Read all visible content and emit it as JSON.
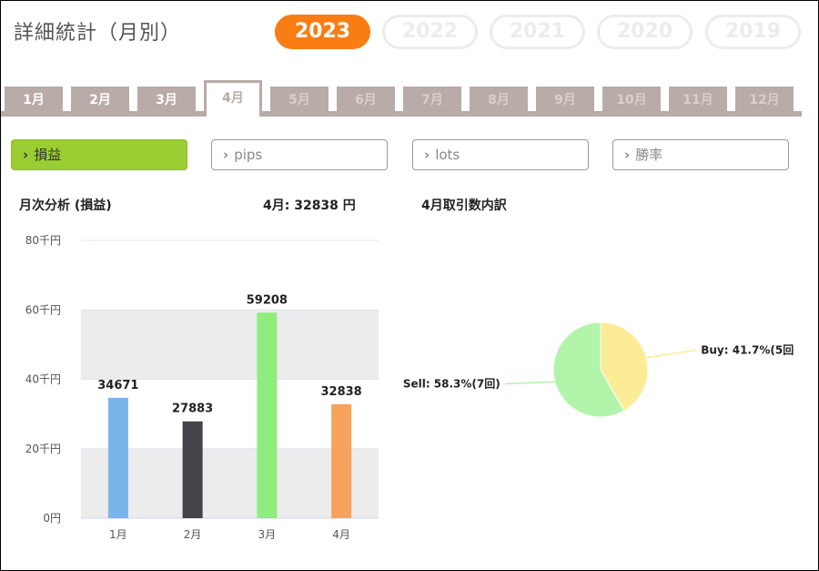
{
  "page_title": "詳細統計（月別）",
  "years": [
    {
      "label": "2023",
      "active": true
    },
    {
      "label": "2022",
      "active": false
    },
    {
      "label": "2021",
      "active": false
    },
    {
      "label": "2020",
      "active": false
    },
    {
      "label": "2019",
      "active": false
    }
  ],
  "months": [
    {
      "label": "1月",
      "state": "normal"
    },
    {
      "label": "2月",
      "state": "normal"
    },
    {
      "label": "3月",
      "state": "normal"
    },
    {
      "label": "4月",
      "state": "active"
    },
    {
      "label": "5月",
      "state": "dim"
    },
    {
      "label": "6月",
      "state": "dim"
    },
    {
      "label": "7月",
      "state": "dim"
    },
    {
      "label": "8月",
      "state": "dim"
    },
    {
      "label": "9月",
      "state": "dim"
    },
    {
      "label": "10月",
      "state": "dim"
    },
    {
      "label": "11月",
      "state": "dim"
    },
    {
      "label": "12月",
      "state": "dim"
    }
  ],
  "metric_buttons": [
    {
      "label": "損益",
      "active": true
    },
    {
      "label": "pips",
      "active": false
    },
    {
      "label": "lots",
      "active": false
    },
    {
      "label": "勝率",
      "active": false
    }
  ],
  "colors": {
    "year_active": "#fa7d14",
    "tab": "#b9aba7",
    "button_active": "#9acd32"
  },
  "bar_section": {
    "title": "月次分析 (損益)",
    "summary": "4月:  32838 円"
  },
  "pie_section": {
    "title": "4月取引数内訳"
  },
  "chart_data": [
    {
      "type": "bar",
      "categories": [
        "1月",
        "2月",
        "3月",
        "4月"
      ],
      "values": [
        34671,
        27883,
        59208,
        32838
      ],
      "colors": [
        "#7ab4ea",
        "#434348",
        "#90ed7d",
        "#f7a35c"
      ],
      "y_ticks": [
        {
          "value": 0,
          "label": "0円"
        },
        {
          "value": 20000,
          "label": "20千円"
        },
        {
          "value": 40000,
          "label": "40千円"
        },
        {
          "value": 60000,
          "label": "60千円"
        },
        {
          "value": 80000,
          "label": "80千円"
        }
      ],
      "ylim": [
        0,
        80000
      ],
      "grid": true
    },
    {
      "type": "pie",
      "slices": [
        {
          "label": "Buy: 41.7%(5回",
          "value": 41.7,
          "color": "#fdec96"
        },
        {
          "label": "Sell: 58.3%(7回)",
          "value": 58.3,
          "color": "#b2f4a9"
        }
      ]
    }
  ]
}
